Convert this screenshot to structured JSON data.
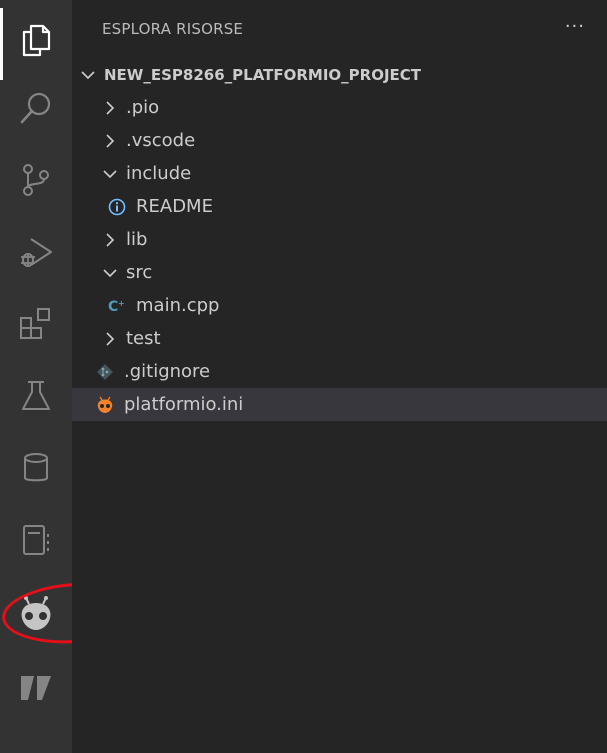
{
  "sidebar": {
    "title": "ESPLORA RISORSE",
    "more_actions": "···"
  },
  "activity_bar": {
    "items": [
      {
        "name": "explorer-icon",
        "active": true
      },
      {
        "name": "search-icon"
      },
      {
        "name": "source-control-icon"
      },
      {
        "name": "run-debug-icon"
      },
      {
        "name": "extensions-icon"
      },
      {
        "name": "testing-icon"
      },
      {
        "name": "database-icon"
      },
      {
        "name": "notebook-icon"
      },
      {
        "name": "platformio-icon",
        "highlighted": true
      },
      {
        "name": "bookmark-flag-icon"
      }
    ]
  },
  "tree": {
    "root": "NEW_ESP8266_PLATFORMIO_PROJECT",
    "items": [
      {
        "label": ".pio",
        "type": "folder",
        "expanded": false
      },
      {
        "label": ".vscode",
        "type": "folder",
        "expanded": false
      },
      {
        "label": "include",
        "type": "folder",
        "expanded": true
      },
      {
        "label": "README",
        "type": "info-file"
      },
      {
        "label": "lib",
        "type": "folder",
        "expanded": false
      },
      {
        "label": "src",
        "type": "folder",
        "expanded": true
      },
      {
        "label": "main.cpp",
        "type": "cpp-file"
      },
      {
        "label": "test",
        "type": "folder",
        "expanded": false
      },
      {
        "label": ".gitignore",
        "type": "git-file"
      },
      {
        "label": "platformio.ini",
        "type": "platformio-file",
        "selected": true
      }
    ]
  },
  "colors": {
    "activity_bar_bg": "#333333",
    "sidebar_bg": "#252526",
    "selection_bg": "#37373d",
    "annotation_red": "#e3101a",
    "platformio_orange": "#f5822a",
    "info_blue": "#75beff",
    "cpp_blue": "#519aba"
  }
}
